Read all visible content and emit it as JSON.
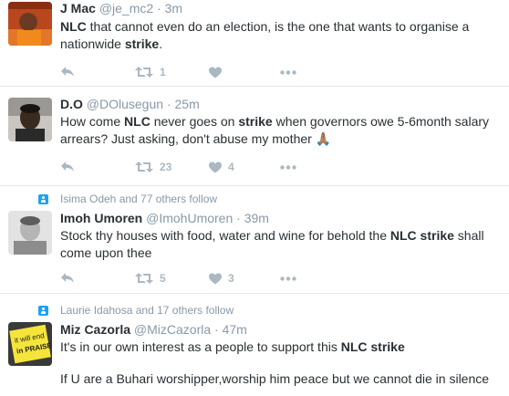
{
  "tweets": [
    {
      "name": "J Mac",
      "handle": "@je_mc2",
      "time": "3m",
      "segments": [
        {
          "t": "NLC",
          "b": true
        },
        {
          "t": " that cannot even do an election, is the one that wants to organise a nationwide ",
          "b": false
        },
        {
          "t": "strike",
          "b": true
        },
        {
          "t": ".",
          "b": false
        }
      ],
      "retweets": "1",
      "likes": "",
      "avatar_icon": "avatar-orange-photo"
    },
    {
      "name": "D.O",
      "handle": "@DOlusegun",
      "time": "25m",
      "segments": [
        {
          "t": "How come ",
          "b": false
        },
        {
          "t": "NLC",
          "b": true
        },
        {
          "t": " never goes on ",
          "b": false
        },
        {
          "t": "strike",
          "b": true
        },
        {
          "t": " when governors owe 5-6month salary arrears? Just asking, don't abuse my mother ",
          "b": false
        },
        {
          "t": "🙏🏽",
          "b": false
        }
      ],
      "retweets": "23",
      "likes": "4",
      "avatar_icon": "avatar-portrait-photo"
    },
    {
      "context": "Isima Odeh and 77 others follow",
      "name": "Imoh Umoren",
      "handle": "@ImohUmoren",
      "time": "39m",
      "segments": [
        {
          "t": "Stock thy houses with food, water and wine for behold the ",
          "b": false
        },
        {
          "t": "NLC strike",
          "b": true
        },
        {
          "t": " shall come upon thee",
          "b": false
        }
      ],
      "retweets": "5",
      "likes": "3",
      "avatar_icon": "avatar-grey-photo"
    },
    {
      "context": "Laurie Idahosa and 17 others follow",
      "name": "Miz Cazorla",
      "handle": "@MizCazorla",
      "time": "47m",
      "segments": [
        {
          "t": "It's in our own interest as a people to support this ",
          "b": false
        },
        {
          "t": "NLC strike",
          "b": true
        }
      ],
      "text2": "If U are a Buhari worshipper,worship him peace but we cannot die in silence",
      "avatar_text": "it will end in PRAISE",
      "avatar_icon": "avatar-sticky-note"
    }
  ],
  "colors": {
    "icon": "#aab8c2",
    "muted": "#8899a6",
    "accent": "#1da1f2",
    "text": "#292f33"
  }
}
